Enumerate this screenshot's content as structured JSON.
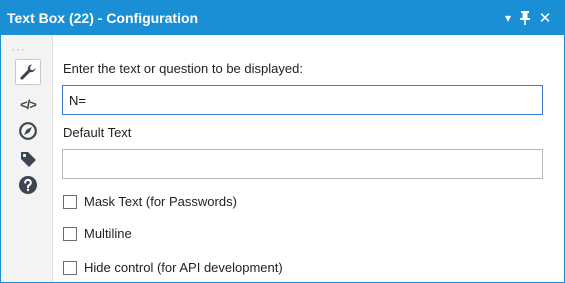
{
  "window": {
    "title": "Text Box (22) - Configuration",
    "controls": {
      "menu_glyph": "▾",
      "close_glyph": "✕"
    }
  },
  "sidebar": {
    "items": [
      {
        "icon": "wrench-icon",
        "active": true
      },
      {
        "icon": "code-icon",
        "label": "</>"
      },
      {
        "icon": "compass-icon"
      },
      {
        "icon": "tag-icon"
      },
      {
        "icon": "help-icon",
        "label": "?"
      }
    ]
  },
  "form": {
    "prompt_label": "Enter the text or question to be displayed:",
    "prompt_value": "N=",
    "default_label": "Default Text",
    "default_value": "",
    "checkboxes": [
      {
        "label": "Mask Text (for Passwords)",
        "checked": false
      },
      {
        "label": "Multiline",
        "checked": false
      },
      {
        "label": "Hide control (for API development)",
        "checked": false
      }
    ]
  },
  "colors": {
    "accent": "#1a8fd6",
    "focus_border": "#3a7bd5",
    "icon": "#3d4650"
  }
}
